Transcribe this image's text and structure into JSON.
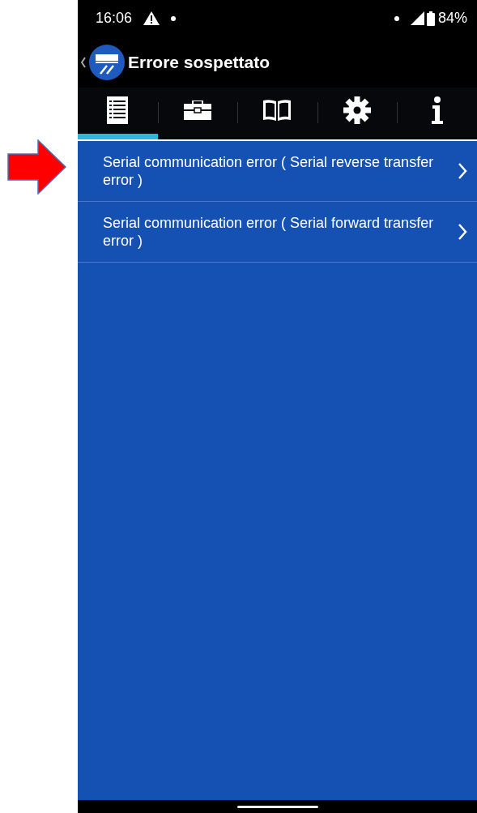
{
  "status_bar": {
    "time": "16:06",
    "battery": "84%"
  },
  "header": {
    "title": "Errore sospettato"
  },
  "tabs": [
    {
      "kind": "list",
      "selected": true
    },
    {
      "kind": "toolbox",
      "selected": false
    },
    {
      "kind": "book",
      "selected": false
    },
    {
      "kind": "gear",
      "selected": false
    },
    {
      "kind": "info",
      "selected": false
    }
  ],
  "items": [
    {
      "text": "Serial communication error ( Serial reverse transfer error )"
    },
    {
      "text": "Serial communication error ( Serial forward transfer error )"
    }
  ]
}
